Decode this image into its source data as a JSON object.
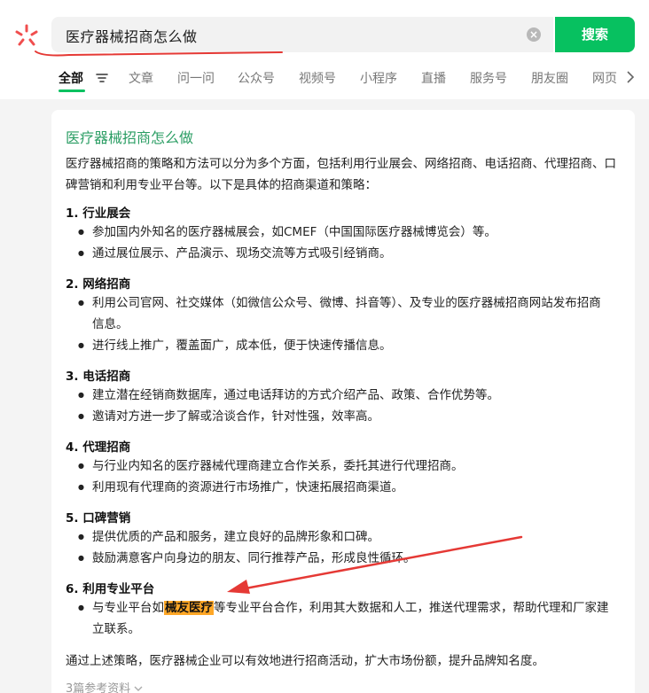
{
  "search": {
    "query": "医疗器械招商怎么做",
    "clear_symbol": "×",
    "button_label": "搜索"
  },
  "tabs": [
    {
      "label": "全部",
      "active": true
    },
    {
      "label": "文章"
    },
    {
      "label": "问一问"
    },
    {
      "label": "公众号"
    },
    {
      "label": "视频号"
    },
    {
      "label": "小程序"
    },
    {
      "label": "直播"
    },
    {
      "label": "服务号"
    },
    {
      "label": "朋友圈"
    },
    {
      "label": "网页"
    }
  ],
  "card": {
    "title": "医疗器械招商怎么做",
    "intro": "医疗器械招商的策略和方法可以分为多个方面，包括利用行业展会、网络招商、电话招商、代理招商、口碑营销和利用专业平台等。以下是具体的招商渠道和策略：",
    "sections": [
      {
        "title": "1. 行业展会",
        "bullets": [
          "参加国内外知名的医疗器械展会，如CMEF（中国国际医疗器械博览会）等。",
          "通过展位展示、产品演示、现场交流等方式吸引经销商。"
        ]
      },
      {
        "title": "2. 网络招商",
        "bullets": [
          "利用公司官网、社交媒体（如微信公众号、微博、抖音等）、及专业的医疗器械招商网站发布招商信息。",
          "进行线上推广，覆盖面广，成本低，便于快速传播信息。"
        ]
      },
      {
        "title": "3. 电话招商",
        "bullets": [
          "建立潜在经销商数据库，通过电话拜访的方式介绍产品、政策、合作优势等。",
          "邀请对方进一步了解或洽谈合作，针对性强，效率高。"
        ]
      },
      {
        "title": "4. 代理招商",
        "bullets": [
          "与行业内知名的医疗器械代理商建立合作关系，委托其进行代理招商。",
          "利用现有代理商的资源进行市场推广，快速拓展招商渠道。"
        ]
      },
      {
        "title": "5. 口碑营销",
        "bullets": [
          "提供优质的产品和服务，建立良好的品牌形象和口碑。",
          "鼓励满意客户向身边的朋友、同行推荐产品，形成良性循环。"
        ]
      },
      {
        "title": "6. 利用专业平台",
        "bullets": []
      }
    ],
    "last_bullet": {
      "before": "与专业平台如",
      "highlight": "械友医疗",
      "after": "等专业平台合作，利用其大数据和人工，推送代理需求，帮助代理和厂家建立联系。"
    },
    "summary": "通过上述策略，医疗器械企业可以有效地进行招商活动，扩大市场份额，提升品牌知名度。",
    "refs": "3篇参考资料"
  },
  "colors": {
    "accent": "#07c160",
    "title_green": "#2a9d63",
    "highlight": "#ffa726",
    "annotation_red": "#e53935"
  },
  "icons": [
    "wechat-search-logo-icon",
    "clear-icon",
    "filter-icon",
    "chevron-right-icon",
    "chevron-down-icon"
  ]
}
